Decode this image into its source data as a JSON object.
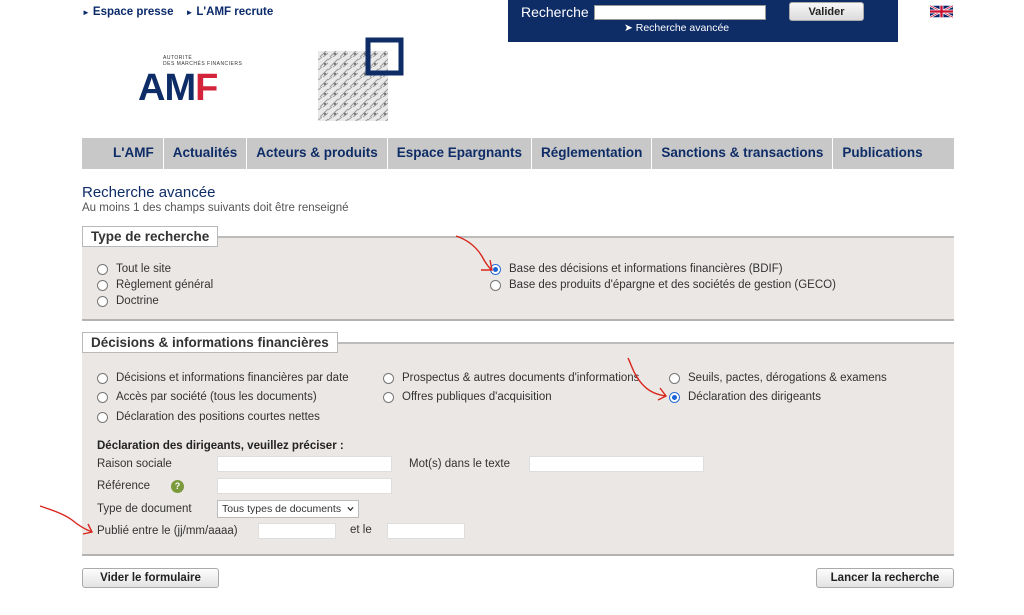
{
  "top_links": [
    "Espace presse",
    "L'AMF recrute"
  ],
  "search": {
    "label": "Recherche",
    "value": "",
    "button": "Valider",
    "advanced_link": "Recherche avancée"
  },
  "logo": {
    "subtitle_line1": "AUTORITÉ",
    "subtitle_line2": "DES MARCHÉS FINANCIERS",
    "word_a": "A",
    "word_m": "M",
    "word_f": "F"
  },
  "nav": [
    "L'AMF",
    "Actualités",
    "Acteurs & produits",
    "Espace Epargnants",
    "Réglementation",
    "Sanctions & transactions",
    "Publications"
  ],
  "page": {
    "title": "Recherche avancée",
    "subtitle": "Au moins 1 des champs suivants doit être renseigné"
  },
  "type_recherche": {
    "legend": "Type de recherche",
    "options": [
      {
        "label": "Tout le site",
        "selected": false
      },
      {
        "label": "Règlement général",
        "selected": false
      },
      {
        "label": "Doctrine",
        "selected": false
      },
      {
        "label": "Base des décisions et informations financières (BDIF)",
        "selected": true
      },
      {
        "label": "Base des produits d'épargne et des sociétés de gestion (GECO)",
        "selected": false
      }
    ]
  },
  "decisions": {
    "legend": "Décisions & informations financières",
    "options": [
      {
        "label": "Décisions et informations financières par date",
        "selected": false
      },
      {
        "label": "Accès par société (tous les documents)",
        "selected": false
      },
      {
        "label": "Déclaration des positions courtes nettes",
        "selected": false
      },
      {
        "label": "Prospectus & autres documents d'informations",
        "selected": false
      },
      {
        "label": "Offres publiques d'acquisition",
        "selected": false
      },
      {
        "label": "Seuils, pactes, dérogations & examens",
        "selected": false
      },
      {
        "label": "Déclaration des dirigeants",
        "selected": true
      }
    ],
    "form_heading": "Déclaration des dirigeants, veuillez préciser :",
    "raison_sociale_label": "Raison sociale",
    "raison_sociale_value": "",
    "mots_label": "Mot(s) dans le texte",
    "mots_value": "",
    "reference_label": "Référence",
    "reference_value": "",
    "help_glyph": "?",
    "type_doc_label": "Type de document",
    "type_doc_value": "Tous types de documents",
    "publie_label": "Publié entre le (jj/mm/aaaa)",
    "date_from": "",
    "et_le_label": "et le",
    "date_to": ""
  },
  "buttons": {
    "reset": "Vider le formulaire",
    "submit": "Lancer la recherche"
  },
  "colors": {
    "brand_navy": "#0e2c66",
    "brand_red": "#d4243b",
    "annotation_red": "#d9261c"
  }
}
